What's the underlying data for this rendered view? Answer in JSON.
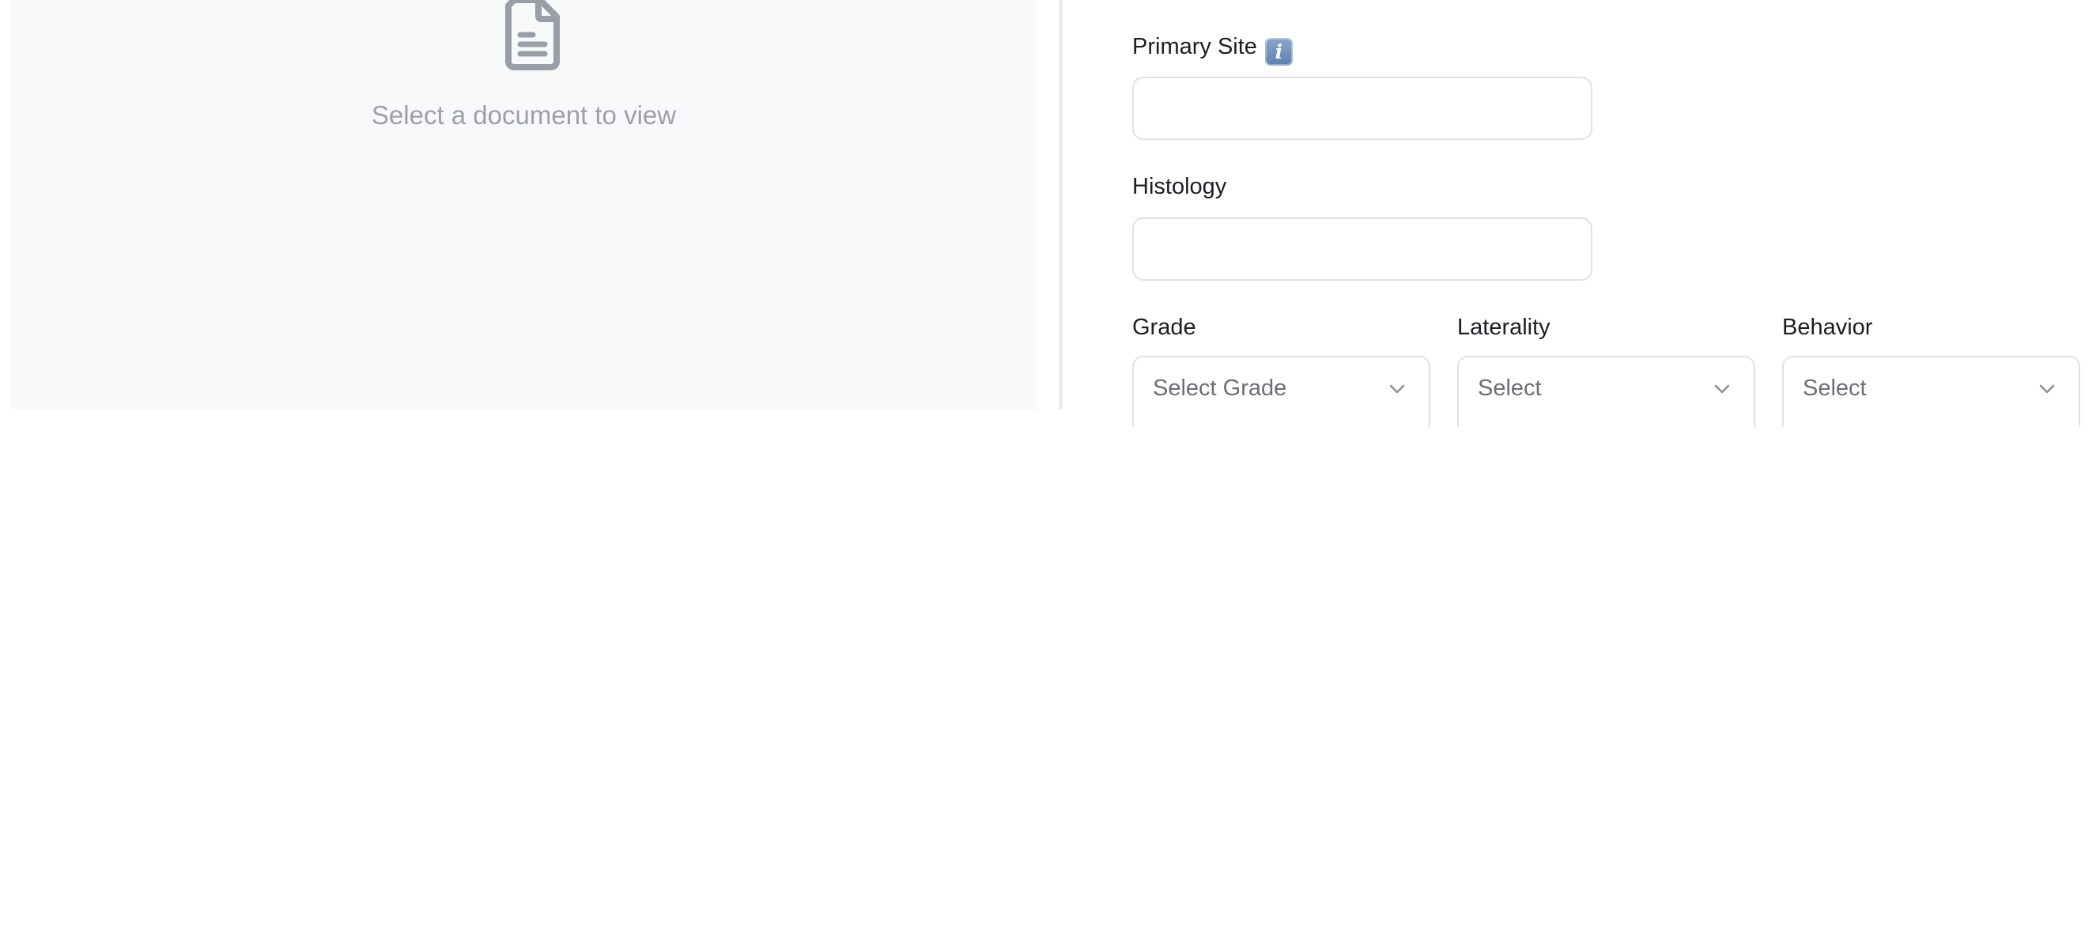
{
  "viewer": {
    "icon": "document-icon",
    "empty_text": "Select a document to view"
  },
  "form": {
    "primary_site": {
      "label": "Primary Site",
      "info_icon": "info-icon",
      "value": ""
    },
    "histology": {
      "label": "Histology",
      "value": ""
    },
    "grade": {
      "label": "Grade",
      "selected": "Select Grade"
    },
    "laterality": {
      "label": "Laterality",
      "selected": "Select"
    },
    "behavior": {
      "label": "Behavior",
      "selected": "Select"
    }
  },
  "colors": {
    "viewer_background": "#f8f9fb",
    "muted_text": "#9ca0a8",
    "border": "#dfe1e5",
    "label_text": "#1c1f24",
    "info_icon": "#6f8fbd"
  }
}
